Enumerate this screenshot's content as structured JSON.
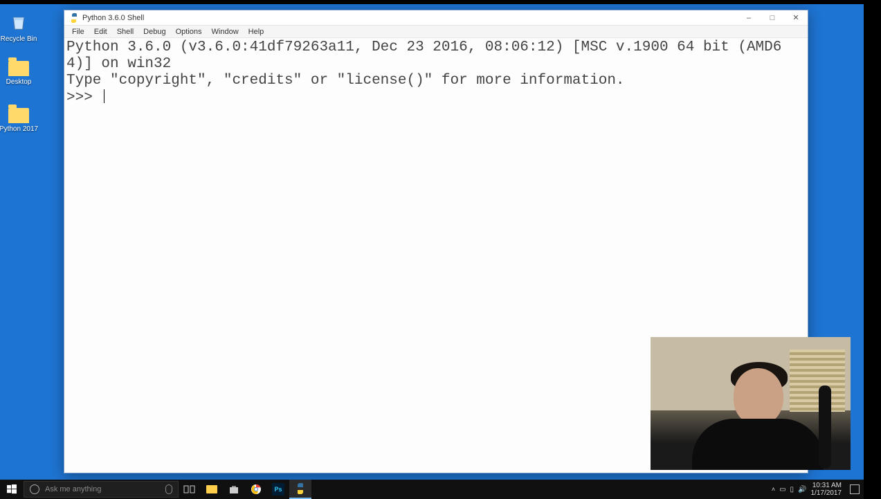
{
  "desktop_icons": [
    {
      "label": "Recycle Bin",
      "kind": "recycle"
    },
    {
      "label": "Desktop",
      "kind": "folder"
    },
    {
      "label": "Python 2017",
      "kind": "folder"
    }
  ],
  "window": {
    "title": "Python 3.6.0 Shell",
    "menus": [
      "File",
      "Edit",
      "Shell",
      "Debug",
      "Options",
      "Window",
      "Help"
    ],
    "controls": {
      "minimize": "–",
      "maximize": "□",
      "close": "✕"
    }
  },
  "shell": {
    "line1": "Python 3.6.0 (v3.6.0:41df79263a11, Dec 23 2016, 08:06:12) [MSC v.1900 64 bit (AMD64)] on win32",
    "line2": "Type \"copyright\", \"credits\" or \"license()\" for more information.",
    "prompt": ">>> "
  },
  "taskbar": {
    "search_placeholder": "Ask me anything",
    "clock_time": "10:31 AM",
    "clock_date": "1/17/2017"
  }
}
